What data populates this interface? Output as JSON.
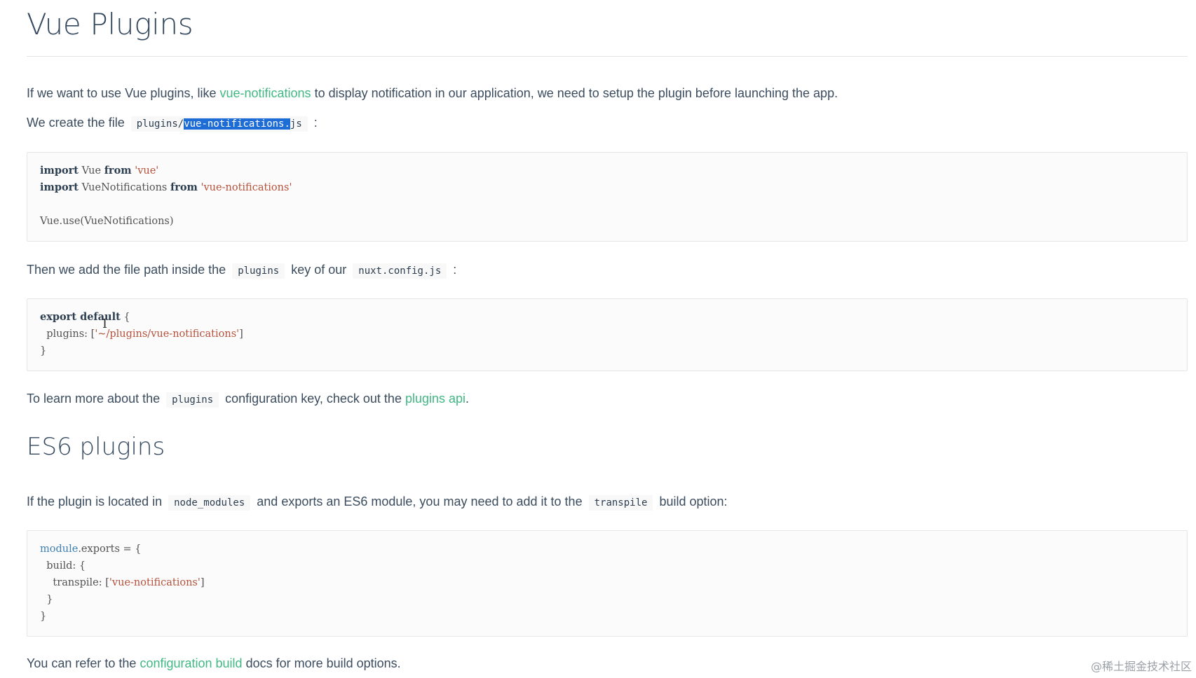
{
  "title": "Vue Plugins",
  "intro": {
    "pre": "If we want to use Vue plugins, like ",
    "link": "vue-notifications",
    "post": " to display notification in our application, we need to setup the plugin before launching the app."
  },
  "create_file": {
    "pre": "We create the file ",
    "code_prefix": "plugins/",
    "code_selected": "vue-notifications.",
    "code_suffix": "js",
    "post": " :"
  },
  "code1": {
    "l1_kw1": "import",
    "l1_id": " Vue ",
    "l1_kw2": "from",
    "l1_str": " 'vue'",
    "l2_kw1": "import",
    "l2_id": " VueNotifications ",
    "l2_kw2": "from",
    "l2_str": " 'vue-notifications'",
    "l4": "Vue.use(VueNotifications)"
  },
  "then_add": {
    "pre": "Then we add the file path inside the ",
    "code1": "plugins",
    "mid": " key of our ",
    "code2": "nuxt.config.js",
    "post": " :"
  },
  "code2": {
    "l1_kw": "export default",
    "l1_rest": " {",
    "l2_pre": "  plugins: [",
    "l2_str": "'~/plugins/vue-notifications'",
    "l2_post": "]",
    "l3": "}"
  },
  "learn_more": {
    "pre": "To learn more about the ",
    "code": "plugins",
    "mid": " configuration key, check out the ",
    "link": "plugins api",
    "post": "."
  },
  "es6_heading": "ES6 plugins",
  "es6_para": {
    "pre": "If the plugin is located in ",
    "code1": "node_modules",
    "mid": " and exports an ES6 module, you may need to add it to the ",
    "code2": "transpile",
    "post": " build option:"
  },
  "code3": {
    "l1_bi": "module",
    "l1_rest": ".exports = {",
    "l2": "  build: {",
    "l3_pre": "    transpile: [",
    "l3_str": "'vue-notifications'",
    "l3_post": "]",
    "l4": "  }",
    "l5": "}"
  },
  "refer": {
    "pre": "You can refer to the ",
    "link": "configuration build",
    "post": " docs for more build options."
  },
  "watermark": "@稀土掘金技术社区",
  "colors": {
    "link": "#41b883",
    "selection": "#1e6cd6",
    "text": "#34495e"
  }
}
